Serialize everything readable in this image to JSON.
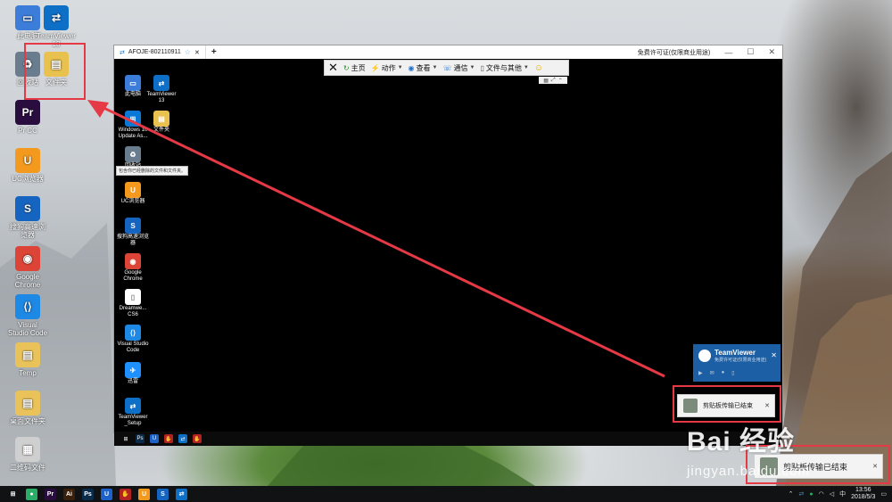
{
  "desktop_icons": [
    {
      "name": "computer",
      "label": "此电脑",
      "color": "#3b7dd8",
      "glyph": "▭"
    },
    {
      "name": "teamviewer",
      "label": "TeamViewer 13",
      "color": "#0e6fc7",
      "glyph": "⇄"
    },
    {
      "name": "recycle-bin",
      "label": "回收站",
      "color": "#6a7d8e",
      "glyph": "♻"
    },
    {
      "name": "new-folder",
      "label": "文件夹",
      "color": "#e8c14f",
      "glyph": "▤"
    },
    {
      "name": "premiere",
      "label": "Pr CC",
      "color": "#2a0d3f",
      "glyph": "Pr"
    },
    {
      "name": "uc-browser",
      "label": "UC浏览器",
      "color": "#f39a1e",
      "glyph": "U"
    },
    {
      "name": "sogou-browser",
      "label": "搜狗高速浏览器",
      "color": "#1565c0",
      "glyph": "S"
    },
    {
      "name": "chrome",
      "label": "Google Chrome",
      "color": "#db4437",
      "glyph": "◉"
    },
    {
      "name": "vscode",
      "label": "Visual Studio Code",
      "color": "#1e88e5",
      "glyph": "⟨⟩"
    },
    {
      "name": "temp",
      "label": "Temp",
      "color": "#e9c25a",
      "glyph": "▤"
    },
    {
      "name": "folder2",
      "label": "桌面文件夹",
      "color": "#e9c25a",
      "glyph": "▤"
    },
    {
      "name": "qr",
      "label": "二维码文件",
      "color": "#cfcfcf",
      "glyph": "▦"
    }
  ],
  "remote_window": {
    "tab_label": "AFOJE-802110911",
    "title_right": "免费许可证(仅限商业用途)",
    "toolbar": [
      {
        "key": "home",
        "label": "主页"
      },
      {
        "key": "actions",
        "label": "动作"
      },
      {
        "key": "view",
        "label": "查看"
      },
      {
        "key": "communicate",
        "label": "通信"
      },
      {
        "key": "files",
        "label": "文件与其他"
      }
    ],
    "icons": [
      {
        "label": "此电脑",
        "color": "#3b7dd8",
        "glyph": "▭"
      },
      {
        "label": "TeamViewer 13",
        "color": "#0e6fc7",
        "glyph": "⇄"
      },
      {
        "label": "Windows 10 Update As...",
        "color": "#0a78d7",
        "glyph": "⊞"
      },
      {
        "label": "文件夹",
        "color": "#e8c14f",
        "glyph": "▤"
      },
      {
        "label": "回收站",
        "color": "#6a7d8e",
        "glyph": "♻"
      },
      {
        "label": "UC浏览器",
        "color": "#f39a1e",
        "glyph": "U"
      },
      {
        "label": "搜狗高速浏览器",
        "color": "#1565c0",
        "glyph": "S"
      },
      {
        "label": "Google Chrome",
        "color": "#db4437",
        "glyph": "◉"
      },
      {
        "label": "Dreamwe... CS6",
        "color": "#ffffff",
        "glyph": "▯"
      },
      {
        "label": "Visual Studio Code",
        "color": "#1e88e5",
        "glyph": "⟨⟩"
      },
      {
        "label": "迅雷",
        "color": "#1e90ff",
        "glyph": "✈"
      },
      {
        "label": "TeamViewer _Setup",
        "color": "#0e6fc7",
        "glyph": "⇄"
      }
    ],
    "tooltip": "包含你已经删除的文件和文件夹。",
    "notification": "剪贴板传输已结束"
  },
  "tv_panel": {
    "title": "TeamViewer",
    "subtitle": "免费许可证(仅限商业用途)"
  },
  "host_notification": "剪贴板传输已结束",
  "taskbar": {
    "apps": [
      {
        "name": "wechat",
        "glyph": "●",
        "color": "#2aae67"
      },
      {
        "name": "premiere",
        "glyph": "Pr",
        "color": "#2a0d3f"
      },
      {
        "name": "illustrator",
        "glyph": "Ai",
        "color": "#3a1f0a"
      },
      {
        "name": "photoshop",
        "glyph": "Ps",
        "color": "#0b2b4a"
      },
      {
        "name": "uc",
        "glyph": "U",
        "color": "#1c62c8"
      },
      {
        "name": "hand-app",
        "glyph": "✋",
        "color": "#b22222"
      },
      {
        "name": "uc-browser",
        "glyph": "U",
        "color": "#f39a1e"
      },
      {
        "name": "sogou",
        "glyph": "S",
        "color": "#1565c0"
      },
      {
        "name": "teamviewer",
        "glyph": "⇄",
        "color": "#0e6fc7"
      }
    ],
    "ime": "中",
    "time": "13:56",
    "date": "2018/5/3"
  },
  "watermark": {
    "main": "Bai 经验",
    "sub": "jingyan.baidu.com"
  }
}
